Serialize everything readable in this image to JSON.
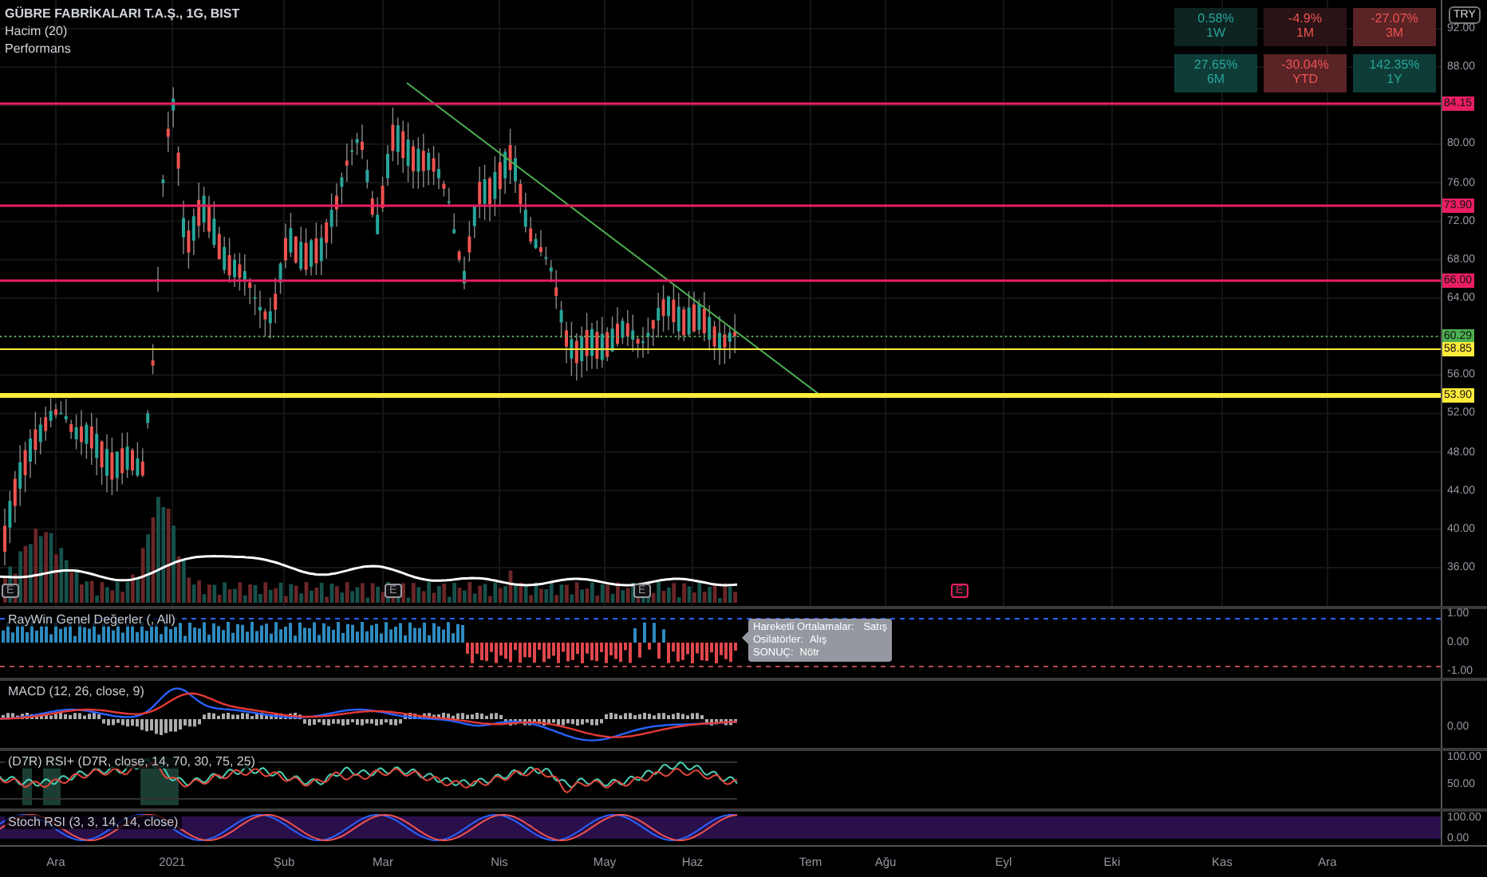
{
  "symbol": {
    "title": "GÜBRE FABRİKALARI T.A.Ş., 1G, BIST",
    "studies": [
      "Hacim (20)",
      "Performans"
    ]
  },
  "performance": [
    {
      "value": "0.58%",
      "period": "1W",
      "kind": "gain",
      "color": "#0d2421"
    },
    {
      "value": "-4.9%",
      "period": "1M",
      "kind": "loss",
      "color": "#2a1316"
    },
    {
      "value": "-27.07%",
      "period": "3M",
      "kind": "loss",
      "color": "#5a2326"
    },
    {
      "value": "27.65%",
      "period": "6M",
      "kind": "gain",
      "color": "#0f3c37"
    },
    {
      "value": "-30.04%",
      "period": "YTD",
      "kind": "loss",
      "color": "#5a2326"
    },
    {
      "value": "142.35%",
      "period": "1Y",
      "kind": "gain",
      "color": "#0f3c37"
    }
  ],
  "currency": "TRY",
  "price_axis": {
    "ticks": [
      "92.00",
      "88.00",
      "80.00",
      "76.00",
      "72.00",
      "68.00",
      "64.00",
      "56.00",
      "52.00",
      "48.00",
      "44.00",
      "40.00",
      "36.00"
    ]
  },
  "price_lines": [
    {
      "label": "84.15",
      "color": "#e91e63"
    },
    {
      "label": "73.90",
      "color": "#e91e63"
    },
    {
      "label": "66.00",
      "color": "#e91e63"
    },
    {
      "label": "60.29",
      "color": "#4caf50"
    },
    {
      "label": "58.85",
      "color": "#ffeb3b"
    },
    {
      "label": "53.90",
      "color": "#ffeb3b"
    }
  ],
  "events": [
    {
      "label": "E",
      "color": "#9598a1"
    },
    {
      "label": "E",
      "color": "#9598a1"
    },
    {
      "label": "E",
      "color": "#9598a1"
    },
    {
      "label": "E",
      "color": "#e91e63"
    }
  ],
  "tooltip": {
    "rows": [
      {
        "label": "Hareketli Ortalamalar:",
        "value": "Satış"
      },
      {
        "label": "Osilatörler:",
        "value": "Alış"
      },
      {
        "label": "SONUÇ:",
        "value": "Nötr"
      }
    ]
  },
  "indicators": [
    {
      "title": "RayWin Genel Değerler (, All)",
      "ticks": [
        "1.00",
        "0.00",
        "-1.00"
      ]
    },
    {
      "title": "MACD (12, 26, close, 9)",
      "ticks": [
        "0.00"
      ]
    },
    {
      "title": "(D7R) RSI+ (D7R, close, 14, 70, 30, 75, 25)",
      "ticks": [
        "100.00",
        "50.00"
      ]
    },
    {
      "title": "Stoch RSI (3, 3, 14, 14, close)",
      "ticks": [
        "100.00",
        "0.00"
      ]
    }
  ],
  "time_axis": [
    "Ara",
    "2021",
    "Şub",
    "Mar",
    "Nis",
    "May",
    "Haz",
    "Tem",
    "Ağu",
    "Eyl",
    "Eki",
    "Kas",
    "Ara"
  ]
}
